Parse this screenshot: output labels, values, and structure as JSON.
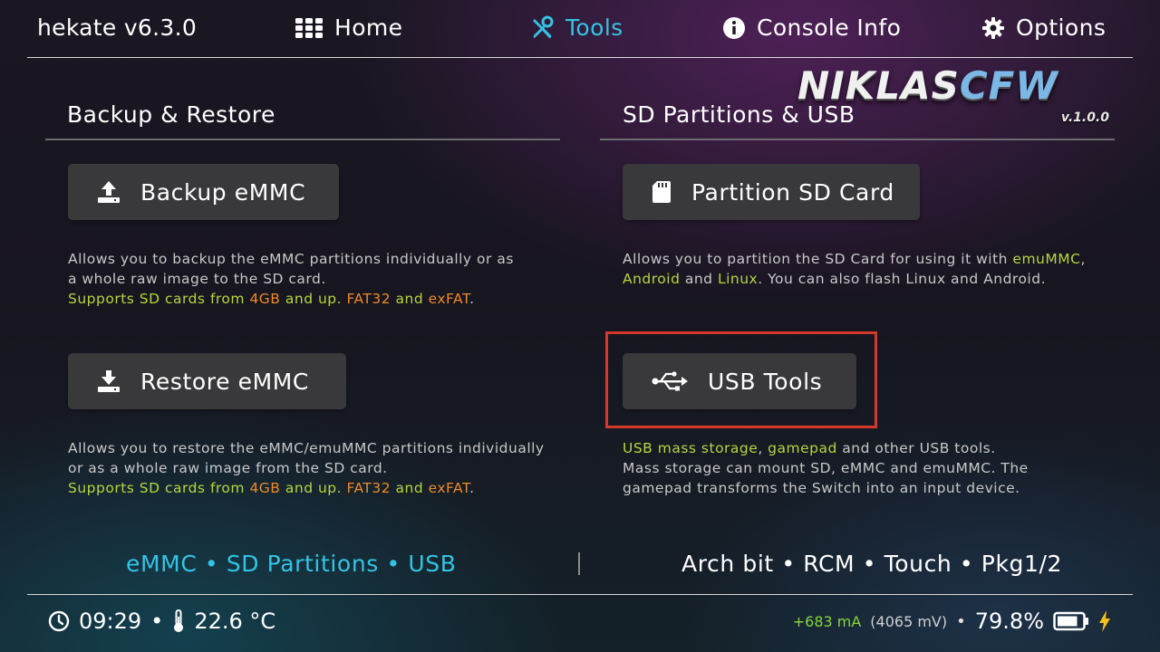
{
  "app": {
    "title": "hekate v6.3.0"
  },
  "nav": {
    "tabs": [
      {
        "label": "Home",
        "icon": "grid-icon",
        "active": false
      },
      {
        "label": "Tools",
        "icon": "tools-icon",
        "active": true
      },
      {
        "label": "Console Info",
        "icon": "info-icon",
        "active": false
      },
      {
        "label": "Options",
        "icon": "gear-icon",
        "active": false
      }
    ]
  },
  "logo": {
    "text_a": "NIKLAS",
    "text_b": "CFW",
    "version": "v.1.0.0"
  },
  "sections": {
    "backup_restore": {
      "title": "Backup & Restore",
      "backup_button": "Backup eMMC",
      "backup_desc": {
        "line1": "Allows you to backup the eMMC partitions individually or as",
        "line2": "a whole raw image to the SD card.",
        "line3": {
          "a": "Supports SD cards from ",
          "b": "4GB",
          "c": " and up. ",
          "d": "FAT32",
          "e": " and ",
          "f": "exFAT",
          "g": "."
        }
      },
      "restore_button": "Restore eMMC",
      "restore_desc": {
        "line1": "Allows you to restore the eMMC/emuMMC partitions individually",
        "line2": "or as a whole raw image from the SD card.",
        "line3": {
          "a": "Supports SD cards from ",
          "b": "4GB",
          "c": " and up. ",
          "d": "FAT32",
          "e": " and ",
          "f": "exFAT",
          "g": "."
        }
      }
    },
    "sd_usb": {
      "title": "SD Partitions & USB",
      "partition_button": "Partition SD Card",
      "partition_desc": {
        "line1": {
          "a": "Allows you to partition the SD Card for using it with ",
          "b": "emuMMC",
          "c": ","
        },
        "line2": {
          "a": "Android",
          "b": " and ",
          "c": "Linux",
          "d": ". You can also flash Linux and Android."
        }
      },
      "usb_button": "USB Tools",
      "usb_desc": {
        "line1": {
          "a": "USB mass storage",
          "b": ", ",
          "c": "gamepad",
          "d": " and other USB tools."
        },
        "line2": "Mass storage can mount SD, eMMC and emuMMC. The",
        "line3": "gamepad transforms the Switch into an input device."
      }
    }
  },
  "features": {
    "left": "eMMC • SD Partitions • USB",
    "right": "Arch bit • RCM • Touch • Pkg1/2"
  },
  "status": {
    "time": "09:29",
    "bullet": "•",
    "temperature": "22.6 °C",
    "current": "+683 mA",
    "voltage": "(4065 mV)",
    "battery_percent": "79.8%",
    "battery_level": 0.798
  },
  "colors": {
    "accent": "#34c3e4",
    "highlight": "#b5d63d",
    "warning": "#ee8a2c",
    "selection_box": "#d6382b",
    "charging": "#f2c11c"
  }
}
